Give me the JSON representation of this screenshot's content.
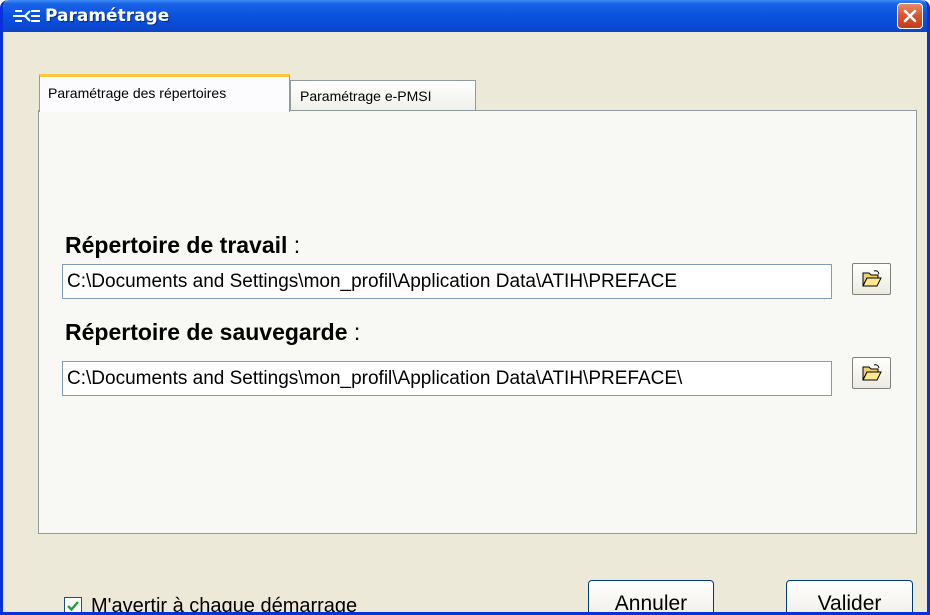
{
  "window": {
    "title": "Paramétrage"
  },
  "tabs": [
    {
      "label": "Paramétrage des répertoires",
      "active": true
    },
    {
      "label": "Paramétrage e-PMSI",
      "active": false
    }
  ],
  "fields": {
    "working_dir": {
      "label": "Répertoire de travail",
      "colon": " :",
      "value": "C:\\Documents and Settings\\mon_profil\\Application Data\\ATIH\\PREFACE"
    },
    "backup_dir": {
      "label": "Répertoire de sauvegarde",
      "colon": " :",
      "value": "C:\\Documents and Settings\\mon_profil\\Application Data\\ATIH\\PREFACE\\"
    }
  },
  "footer": {
    "warn_on_start_label": "M'avertir à chaque démarrage",
    "warn_on_start_checked": true,
    "cancel_label": "Annuler",
    "validate_label": "Valider"
  },
  "icons": {
    "app": "app-icon",
    "close": "close-icon",
    "browse": "folder-open-icon",
    "checkbox": "checkmark-icon"
  },
  "colors": {
    "titlebar": "#0a54e0",
    "active_tab_accent": "#ffc83c",
    "close_button": "#d9532b",
    "window_bg": "#ece9d8"
  }
}
